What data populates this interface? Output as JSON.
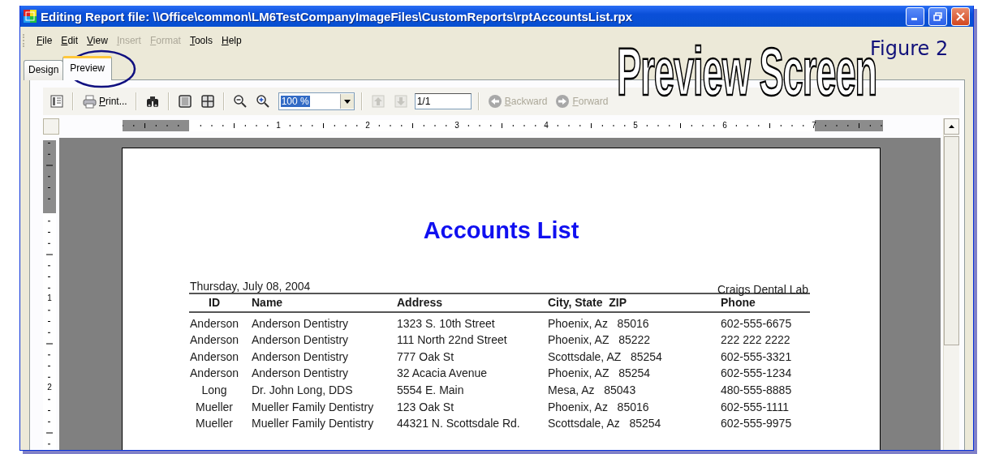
{
  "window": {
    "title": "Editing Report file: \\\\Office\\common\\LM6TestCompanyImageFiles\\CustomReports\\rptAccountsList.rpx"
  },
  "menu": [
    {
      "label": "File",
      "disabled": false
    },
    {
      "label": "Edit",
      "disabled": false
    },
    {
      "label": "View",
      "disabled": false
    },
    {
      "label": "Insert",
      "disabled": true
    },
    {
      "label": "Format",
      "disabled": true
    },
    {
      "label": "Tools",
      "disabled": false
    },
    {
      "label": "Help",
      "disabled": false
    }
  ],
  "tabs": [
    {
      "label": "Design",
      "selected": false
    },
    {
      "label": "Preview",
      "selected": true
    }
  ],
  "toolbar": [
    {
      "kind": "toc",
      "disabled": false
    },
    {
      "kind": "separator"
    },
    {
      "kind": "print",
      "label": "Print...",
      "disabled": false
    },
    {
      "kind": "separator"
    },
    {
      "kind": "find",
      "disabled": false
    },
    {
      "kind": "separator"
    },
    {
      "kind": "single-page",
      "disabled": false
    },
    {
      "kind": "multi-page",
      "disabled": false
    },
    {
      "kind": "separator"
    },
    {
      "kind": "zoom-out",
      "disabled": false
    },
    {
      "kind": "zoom-in",
      "disabled": false
    },
    {
      "kind": "combo",
      "value": "100 %"
    },
    {
      "kind": "separator"
    },
    {
      "kind": "page-up",
      "disabled": true
    },
    {
      "kind": "page-down",
      "disabled": true
    },
    {
      "kind": "field",
      "value": "1/1"
    },
    {
      "kind": "separator"
    },
    {
      "kind": "back",
      "label": "Backward",
      "disabled": true
    },
    {
      "kind": "forward",
      "label": "Forward",
      "disabled": true
    }
  ],
  "ruler": {
    "horizontal_labels": [
      "1",
      "2",
      "3",
      "4",
      "5",
      "6",
      "7"
    ],
    "vertical_labels": [
      "1",
      "2"
    ]
  },
  "report": {
    "title": "Accounts List",
    "date": "Thursday, July 08, 2004",
    "company": "Craigs Dental Lab",
    "columns": [
      "ID",
      "Name",
      "Address",
      "City, State  ZIP",
      "Phone"
    ],
    "rows": [
      [
        "Anderson",
        "Anderson Dentistry",
        "1323 S. 10th Street",
        "Phoenix, Az   85016",
        "602-555-6675"
      ],
      [
        "Anderson",
        "Anderson Dentistry",
        "111 North 22nd Street",
        "Phoenix, AZ   85222",
        "222 222 2222"
      ],
      [
        "Anderson",
        "Anderson Dentistry",
        "777 Oak St",
        "Scottsdale, AZ   85254",
        "602-555-3321"
      ],
      [
        "Anderson",
        "Anderson Dentistry",
        "32 Acacia Avenue",
        "Phoenix, AZ   85254",
        "602-555-1234"
      ],
      [
        "Long",
        "Dr. John Long, DDS",
        "5554 E. Main",
        "Mesa, Az   85043",
        "480-555-8885"
      ],
      [
        "Mueller",
        "Mueller Family Dentistry",
        "123 Oak St",
        "Phoenix, Az   85016",
        "602-555-1111"
      ],
      [
        "Mueller",
        "Mueller Family Dentistry",
        "44321 N. Scottsdale Rd.",
        "Scottsdale, Az   85254",
        "602-555-9975"
      ]
    ]
  },
  "annotations": {
    "heading": "Preview Screen",
    "figure": "Figure 2"
  }
}
